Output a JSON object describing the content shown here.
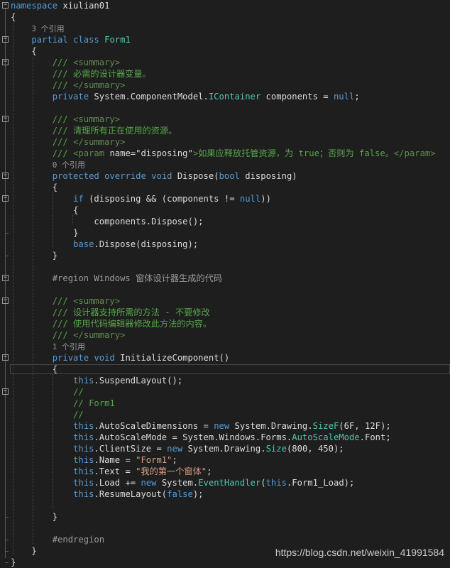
{
  "colors": {
    "background": "#1e1e1e",
    "keyword": "#569cd6",
    "type": "#4ec9b0",
    "comment": "#57a64a",
    "xmldoc": "#608b4e",
    "string": "#d69d85",
    "number": "#b5cea8",
    "plain": "#dcdcdc",
    "codelens": "#999999",
    "region": "#9b9b9b"
  },
  "lines": [
    {
      "id": "namespace-declaration",
      "fold": "minus",
      "tokens": [
        [
          "namespace",
          "keyword"
        ],
        [
          " xiulian01",
          "plain"
        ]
      ]
    },
    {
      "id": "namespace-open-brace",
      "tokens": [
        [
          "{",
          "plain"
        ]
      ]
    },
    {
      "id": "codelens-form1",
      "kind": "codelens",
      "indent": "    ",
      "tokens": [
        [
          "3 个引用",
          "codelens"
        ]
      ]
    },
    {
      "id": "class-declaration",
      "fold": "minus",
      "indent": "    ",
      "tokens": [
        [
          "partial",
          "keyword"
        ],
        [
          " ",
          "plain"
        ],
        [
          "class",
          "keyword"
        ],
        [
          " ",
          "plain"
        ],
        [
          "Form1",
          "type"
        ]
      ]
    },
    {
      "id": "class-open-brace",
      "indent": "    ",
      "tokens": [
        [
          "{",
          "plain"
        ]
      ]
    },
    {
      "id": "xmldoc-summary-open",
      "fold": "minus",
      "indent": "        ",
      "tokens": [
        [
          "/// ",
          "comment"
        ],
        [
          "<summary>",
          "xmldoc"
        ]
      ]
    },
    {
      "id": "xmldoc-components-text",
      "indent": "        ",
      "tokens": [
        [
          "/// 必需的设计器变量。",
          "comment"
        ]
      ]
    },
    {
      "id": "xmldoc-summary-close",
      "indent": "        ",
      "tokens": [
        [
          "/// ",
          "comment"
        ],
        [
          "</summary>",
          "xmldoc"
        ]
      ]
    },
    {
      "id": "components-field",
      "indent": "        ",
      "tokens": [
        [
          "private",
          "keyword"
        ],
        [
          " System.ComponentModel.",
          "plain"
        ],
        [
          "IContainer",
          "type"
        ],
        [
          " components = ",
          "plain"
        ],
        [
          "null",
          "keyword"
        ],
        [
          ";",
          "plain"
        ]
      ]
    },
    {
      "id": "blank-1",
      "tokens": []
    },
    {
      "id": "xmldoc-dispose-summary-open",
      "fold": "minus",
      "indent": "        ",
      "tokens": [
        [
          "/// ",
          "comment"
        ],
        [
          "<summary>",
          "xmldoc"
        ]
      ]
    },
    {
      "id": "xmldoc-dispose-text",
      "indent": "        ",
      "tokens": [
        [
          "/// 清理所有正在使用的资源。",
          "comment"
        ]
      ]
    },
    {
      "id": "xmldoc-dispose-summary-close",
      "indent": "        ",
      "tokens": [
        [
          "/// ",
          "comment"
        ],
        [
          "</summary>",
          "xmldoc"
        ]
      ]
    },
    {
      "id": "xmldoc-param",
      "indent": "        ",
      "tokens": [
        [
          "/// ",
          "comment"
        ],
        [
          "<param ",
          "xmldoc"
        ],
        [
          "name=\"disposing\"",
          "plain"
        ],
        [
          ">",
          "xmldoc"
        ],
        [
          "如果应释放托管资源，为 true；否则为 false。",
          "comment"
        ],
        [
          "</param>",
          "xmldoc"
        ]
      ]
    },
    {
      "id": "codelens-dispose",
      "kind": "codelens",
      "indent": "        ",
      "tokens": [
        [
          "0 个引用",
          "codelens"
        ]
      ]
    },
    {
      "id": "dispose-signature",
      "fold": "minus",
      "indent": "        ",
      "tokens": [
        [
          "protected",
          "keyword"
        ],
        [
          " ",
          "plain"
        ],
        [
          "override",
          "keyword"
        ],
        [
          " ",
          "plain"
        ],
        [
          "void",
          "keyword"
        ],
        [
          " Dispose(",
          "plain"
        ],
        [
          "bool",
          "keyword"
        ],
        [
          " disposing)",
          "plain"
        ]
      ]
    },
    {
      "id": "dispose-open-brace",
      "indent": "        ",
      "tokens": [
        [
          "{",
          "plain"
        ]
      ]
    },
    {
      "id": "if-statement",
      "fold": "minus",
      "indent": "            ",
      "tokens": [
        [
          "if",
          "keyword"
        ],
        [
          " (disposing && (components != ",
          "plain"
        ],
        [
          "null",
          "keyword"
        ],
        [
          "))",
          "plain"
        ]
      ]
    },
    {
      "id": "if-open-brace",
      "indent": "            ",
      "tokens": [
        [
          "{",
          "plain"
        ]
      ]
    },
    {
      "id": "components-dispose-call",
      "indent": "                ",
      "tokens": [
        [
          "components.Dispose();",
          "plain"
        ]
      ]
    },
    {
      "id": "if-close-brace",
      "indent": "            ",
      "tokens": [
        [
          "}",
          "plain"
        ]
      ]
    },
    {
      "id": "base-dispose-call",
      "indent": "            ",
      "tokens": [
        [
          "base",
          "keyword"
        ],
        [
          ".Dispose(disposing);",
          "plain"
        ]
      ]
    },
    {
      "id": "dispose-close-brace",
      "indent": "        ",
      "tokens": [
        [
          "}",
          "plain"
        ]
      ]
    },
    {
      "id": "blank-2",
      "tokens": []
    },
    {
      "id": "region-start",
      "fold": "minus",
      "indent": "        ",
      "tokens": [
        [
          "#region Windows 窗体设计器生成的代码",
          "region"
        ]
      ]
    },
    {
      "id": "blank-3",
      "tokens": []
    },
    {
      "id": "xmldoc-init-summary-open",
      "fold": "minus",
      "indent": "        ",
      "tokens": [
        [
          "/// ",
          "comment"
        ],
        [
          "<summary>",
          "xmldoc"
        ]
      ]
    },
    {
      "id": "xmldoc-init-text-1",
      "indent": "        ",
      "tokens": [
        [
          "/// 设计器支持所需的方法 - 不要修改",
          "comment"
        ]
      ]
    },
    {
      "id": "xmldoc-init-text-2",
      "indent": "        ",
      "tokens": [
        [
          "/// 使用代码编辑器修改此方法的内容。",
          "comment"
        ]
      ]
    },
    {
      "id": "xmldoc-init-summary-close",
      "indent": "        ",
      "tokens": [
        [
          "/// ",
          "comment"
        ],
        [
          "</summary>",
          "xmldoc"
        ]
      ]
    },
    {
      "id": "codelens-initialize",
      "kind": "codelens",
      "indent": "        ",
      "tokens": [
        [
          "1 个引用",
          "codelens"
        ]
      ]
    },
    {
      "id": "initialize-signature",
      "fold": "minus",
      "indent": "        ",
      "tokens": [
        [
          "private",
          "keyword"
        ],
        [
          " ",
          "plain"
        ],
        [
          "void",
          "keyword"
        ],
        [
          " InitializeComponent()",
          "plain"
        ]
      ]
    },
    {
      "id": "initialize-open-brace",
      "current": true,
      "indent": "        ",
      "tokens": [
        [
          "{",
          "plain"
        ]
      ]
    },
    {
      "id": "suspend-layout",
      "indent": "            ",
      "tokens": [
        [
          "this",
          "keyword"
        ],
        [
          ".SuspendLayout();",
          "plain"
        ]
      ]
    },
    {
      "id": "comment-slash-1",
      "fold": "minus",
      "indent": "            ",
      "tokens": [
        [
          "//",
          "comment"
        ]
      ]
    },
    {
      "id": "comment-form1",
      "indent": "            ",
      "tokens": [
        [
          "// Form1",
          "comment"
        ]
      ]
    },
    {
      "id": "comment-slash-2",
      "indent": "            ",
      "tokens": [
        [
          "//",
          "comment"
        ]
      ]
    },
    {
      "id": "autoscale-dimensions",
      "indent": "            ",
      "tokens": [
        [
          "this",
          "keyword"
        ],
        [
          ".AutoScaleDimensions = ",
          "plain"
        ],
        [
          "new",
          "keyword"
        ],
        [
          " System.Drawing.",
          "plain"
        ],
        [
          "SizeF",
          "type"
        ],
        [
          "(6F, 12F);",
          "plain"
        ]
      ]
    },
    {
      "id": "autoscale-mode",
      "indent": "            ",
      "tokens": [
        [
          "this",
          "keyword"
        ],
        [
          ".AutoScaleMode = System.Windows.Forms.",
          "plain"
        ],
        [
          "AutoScaleMode",
          "type"
        ],
        [
          ".Font;",
          "plain"
        ]
      ]
    },
    {
      "id": "client-size",
      "indent": "            ",
      "tokens": [
        [
          "this",
          "keyword"
        ],
        [
          ".ClientSize = ",
          "plain"
        ],
        [
          "new",
          "keyword"
        ],
        [
          " System.Drawing.",
          "plain"
        ],
        [
          "Size",
          "type"
        ],
        [
          "(800, 450);",
          "plain"
        ]
      ]
    },
    {
      "id": "name-assignment",
      "indent": "            ",
      "tokens": [
        [
          "this",
          "keyword"
        ],
        [
          ".Name = ",
          "plain"
        ],
        [
          "\"Form1\"",
          "string"
        ],
        [
          ";",
          "plain"
        ]
      ]
    },
    {
      "id": "text-assignment",
      "indent": "            ",
      "tokens": [
        [
          "this",
          "keyword"
        ],
        [
          ".Text = ",
          "plain"
        ],
        [
          "\"我的第一个窗体\"",
          "string"
        ],
        [
          ";",
          "plain"
        ]
      ]
    },
    {
      "id": "load-handler",
      "indent": "            ",
      "tokens": [
        [
          "this",
          "keyword"
        ],
        [
          ".Load += ",
          "plain"
        ],
        [
          "new",
          "keyword"
        ],
        [
          " System.",
          "plain"
        ],
        [
          "EventHandler",
          "type"
        ],
        [
          "(",
          "plain"
        ],
        [
          "this",
          "keyword"
        ],
        [
          ".Form1_Load);",
          "plain"
        ]
      ]
    },
    {
      "id": "resume-layout",
      "indent": "            ",
      "tokens": [
        [
          "this",
          "keyword"
        ],
        [
          ".ResumeLayout(",
          "plain"
        ],
        [
          "false",
          "keyword"
        ],
        [
          ");",
          "plain"
        ]
      ]
    },
    {
      "id": "blank-4",
      "tokens": []
    },
    {
      "id": "initialize-close-brace",
      "indent": "        ",
      "tokens": [
        [
          "}",
          "plain"
        ]
      ]
    },
    {
      "id": "blank-5",
      "tokens": []
    },
    {
      "id": "region-end",
      "indent": "        ",
      "tokens": [
        [
          "#endregion",
          "region"
        ]
      ]
    },
    {
      "id": "class-close-brace",
      "indent": "    ",
      "tokens": [
        [
          "}",
          "plain"
        ]
      ]
    },
    {
      "id": "namespace-close-brace",
      "tokens": [
        [
          "}",
          "plain"
        ]
      ]
    }
  ],
  "watermark": "https://blog.csdn.net/weixin_41991584"
}
